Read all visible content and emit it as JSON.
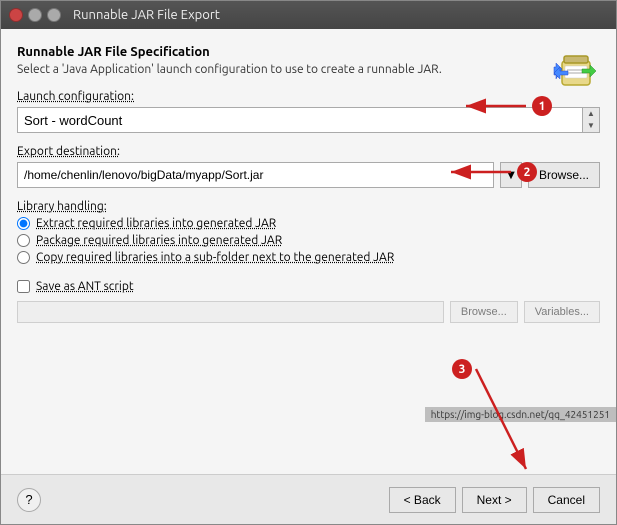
{
  "window": {
    "title": "Runnable JAR File Export"
  },
  "titlebar": {
    "close_label": "×",
    "minimize_label": "−",
    "maximize_label": "□"
  },
  "header": {
    "section_title": "Runnable JAR File Specification",
    "description": "Select a 'Java Application' launch configuration to use to create a runnable JAR."
  },
  "launch_config": {
    "label": "Launch configuration:",
    "value": "Sort - wordCount"
  },
  "export_dest": {
    "label": "Export destination:",
    "value": "/home/chenlin/lenovo/bigData/myapp/Sort.jar",
    "dropdown_arrow": "▼"
  },
  "browse_btn": "Browse...",
  "library_handling": {
    "label": "Library handling:",
    "options": [
      {
        "id": "opt1",
        "label": "Extract required libraries into generated JAR",
        "selected": true
      },
      {
        "id": "opt2",
        "label": "Package required libraries into generated JAR",
        "selected": false
      },
      {
        "id": "opt3",
        "label": "Copy required libraries into a sub-folder next to the generated JAR",
        "selected": false
      }
    ]
  },
  "save_as_ant": {
    "label": "Save as ANT script",
    "checked": false
  },
  "footer": {
    "help_label": "?",
    "back_label": "< Back",
    "next_label": "Next >",
    "cancel_label": "Cancel"
  },
  "annotations": {
    "badge1": "1",
    "badge2": "2",
    "badge3": "3"
  },
  "watermark": "https://img-blog.csdn.net/qq_42451251"
}
